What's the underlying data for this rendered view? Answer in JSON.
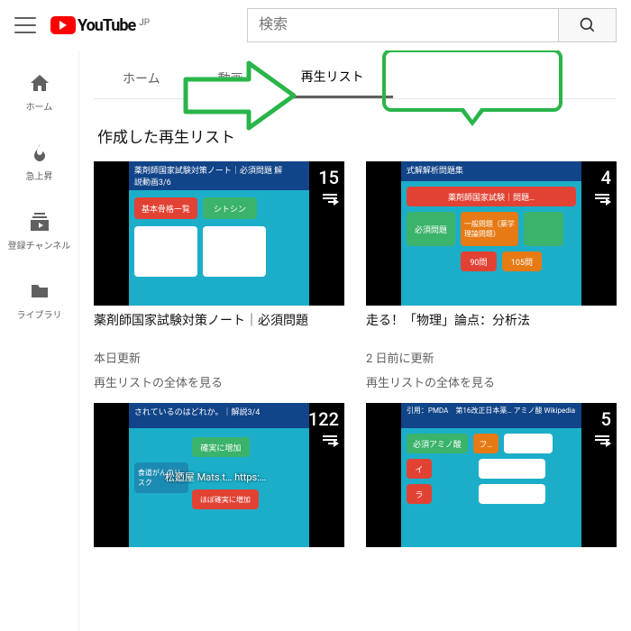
{
  "header": {
    "logo_text": "YouTube",
    "region": "JP",
    "search_placeholder": "検索"
  },
  "sidebar": {
    "items": [
      {
        "label": "ホーム",
        "icon": "home"
      },
      {
        "label": "急上昇",
        "icon": "flame"
      },
      {
        "label": "登録チャンネル",
        "icon": "subs"
      },
      {
        "label": "ライブラリ",
        "icon": "folder"
      }
    ]
  },
  "tabs": [
    {
      "label": "ホーム"
    },
    {
      "label": "動画"
    },
    {
      "label": "再生リスト",
      "selected": true
    }
  ],
  "section_title": "作成した再生リスト",
  "playlists": [
    {
      "count": "15",
      "title": "薬剤師国家試験対策ノート｜必須問題",
      "updated": "本日更新",
      "view_all": "再生リストの全体を見る",
      "thumb": {
        "top_band": "薬剤師国家試験対策ノート｜必須問題 解説動画3/6",
        "tiles": [
          {
            "bg": "#e24234",
            "txt": "基本骨格一覧"
          },
          {
            "bg": "#3bb36a",
            "txt": "シトシン"
          }
        ]
      }
    },
    {
      "count": "4",
      "title": "走る！「物理」論点：分析法",
      "updated": "2 日前に更新",
      "view_all": "再生リストの全体を見る",
      "thumb": {
        "top_band": "式解解析問題集",
        "tiles": [
          {
            "bg": "#e24234",
            "txt": "薬剤師国家試験｜問題…"
          },
          {
            "bg": "#3bb36a",
            "txt": "必須問題"
          },
          {
            "bg": "#e67a14",
            "txt": "一般問題（薬学理論問題）"
          },
          {
            "bg": "#e24234",
            "txt": "90問"
          },
          {
            "bg": "#e67a14",
            "txt": "105問"
          }
        ]
      }
    },
    {
      "count": "122",
      "title": "",
      "updated": "",
      "view_all": "",
      "thumb": {
        "top_band": "されているのはどれか。｜解説3/4",
        "tiles": [
          {
            "bg": "#3bb36a",
            "txt": "確実に増加"
          },
          {
            "bg": "#1c8bb3",
            "txt": "食道がんのリスク"
          },
          {
            "bg": "#e24234",
            "txt": "ほぼ確実に増加"
          }
        ],
        "overlay": "松廼屋 Mats.t…  https:…"
      }
    },
    {
      "count": "5",
      "title": "",
      "updated": "",
      "view_all": "",
      "thumb": {
        "top_band": "引用：PMDA　第16改正日本薬… アミノ酸 Wikipedia",
        "tiles": [
          {
            "bg": "#3bb36a",
            "txt": "必須アミノ酸"
          },
          {
            "bg": "#e67a14",
            "txt": "フ…"
          },
          {
            "bg": "#e24234",
            "txt": "イ"
          },
          {
            "bg": "#e24234",
            "txt": "ラ"
          }
        ]
      }
    }
  ]
}
